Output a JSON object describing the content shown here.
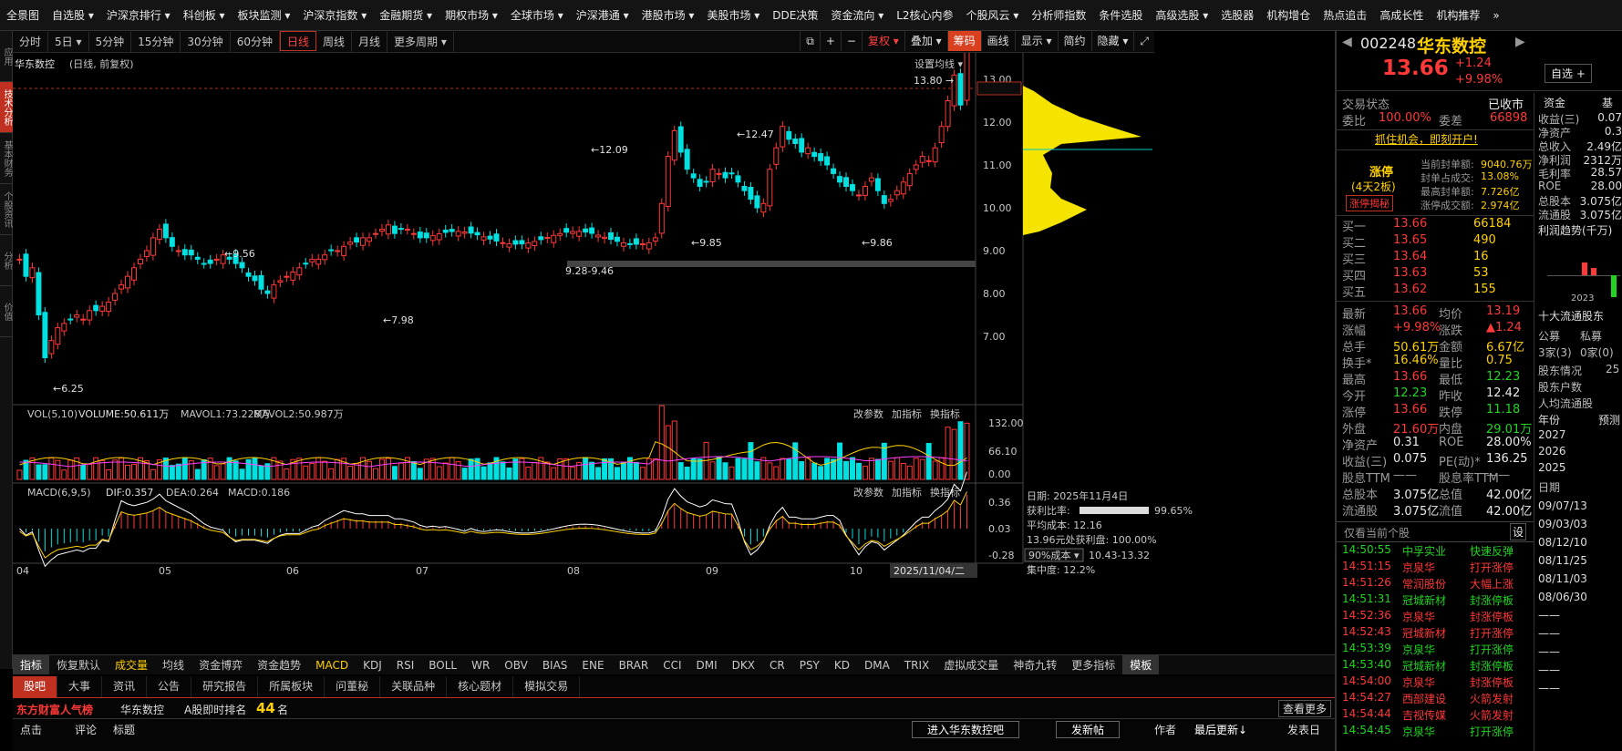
{
  "topmenu": [
    "全景图",
    "自选股 ▾",
    "沪深京排行 ▾",
    "科创板 ▾",
    "板块监测 ▾",
    "沪深京指数 ▾",
    "金融期货 ▾",
    "期权市场 ▾",
    "全球市场 ▾",
    "沪深港通 ▾",
    "港股市场 ▾",
    "美股市场 ▾",
    "DDE决策",
    "资金流向 ▾",
    "L2核心内参",
    "个股风云 ▾",
    "分析师指数",
    "条件选股",
    "高级选股 ▾",
    "选股器",
    "机构增仓",
    "热点追击",
    "高成长性",
    "机构推荐",
    "»"
  ],
  "periods": [
    "分时",
    "5日 ▾",
    "5分钟",
    "15分钟",
    "30分钟",
    "60分钟",
    "日线",
    "周线",
    "月线",
    "更多周期 ▾"
  ],
  "active_period": "日线",
  "toolbar": [
    "⧉",
    "+",
    "−",
    "复权 ▾",
    "叠加 ▾",
    "筹码",
    "画线",
    "显示 ▾",
    "简约",
    "隐藏 ▾",
    "⤢"
  ],
  "lefttabs": [
    "应用",
    "技术分析",
    "基本财务",
    "个股资讯",
    "分析",
    "价值"
  ],
  "stock": {
    "code": "002248",
    "name": "华东数控",
    "price": "13.66",
    "change": "+1.24",
    "pct": "+9.98%",
    "label": "华东数控",
    "sub": "(日线, 前复权)",
    "setting": "设置均线 ▾"
  },
  "chart_data": {
    "type": "candlestick",
    "ylim": [
      6,
      14
    ],
    "price_ticks": [
      "13.66",
      "13.00",
      "12.00",
      "11.00",
      "10.00",
      "9.00",
      "8.00",
      "7.00"
    ],
    "months": [
      "04",
      "05",
      "06",
      "07",
      "08",
      "09",
      "10",
      "11"
    ],
    "x_selected": "2025/11/04/二",
    "annotations": [
      {
        "t": "←6.25"
      },
      {
        "t": "←9.56"
      },
      {
        "t": "←7.98"
      },
      {
        "t": "←12.09"
      },
      {
        "t": "←12.47"
      },
      {
        "t": "←9.85"
      },
      {
        "t": "←9.86"
      },
      {
        "t": "13.80 →"
      },
      {
        "t": "9.28-9.46"
      }
    ],
    "volume": {
      "label": "VOL(5,10)",
      "v": "VOLUME:50.611万",
      "m1": "MAVOL1:73.228万",
      "m2": "MAVOL2:50.987万",
      "ticks": [
        "132.00",
        "66.10",
        "0.00"
      ]
    },
    "macd": {
      "label": "MACD(6,9,5)",
      "dif": "DIF:0.357",
      "dea": "DEA:0.264",
      "macd": "MACD:0.186",
      "ticks": [
        "0.36",
        "0.03",
        "-0.28"
      ]
    },
    "chip": {
      "date": "日期: 2025年11月4日",
      "profit_label": "获利比率:",
      "profit": "99.65%",
      "avg": "平均成本: 12.16",
      "p1396": "13.96元处获利盘: 100.00%",
      "cost_sel": "90%成本 ▾",
      "cost_range": "10.43-13.32",
      "conc": "集中度: 12.2%"
    }
  },
  "panel_btns": [
    "改参数",
    "加指标",
    "换指标"
  ],
  "indicators": [
    "指标",
    "恢复默认",
    "成交量",
    "均线",
    "资金博弈",
    "资金趋势",
    "MACD",
    "KDJ",
    "RSI",
    "BOLL",
    "WR",
    "OBV",
    "BIAS",
    "ENE",
    "BRAR",
    "CCI",
    "DMI",
    "DKX",
    "CR",
    "PSY",
    "KD",
    "DMA",
    "TRIX",
    "虚拟成交量",
    "神奇九转",
    "更多指标",
    "模板"
  ],
  "bottom": {
    "tabs": [
      "股吧",
      "大事",
      "资讯",
      "公告",
      "研究报告",
      "所属板块",
      "问董秘",
      "关联品种",
      "核心题材",
      "模拟交易"
    ],
    "popular": "东方财富人气榜",
    "name": "华东数控",
    "rank_label": "A股即时排名",
    "rank": "44",
    "rank_unit": "名",
    "more": "查看更多",
    "cols": [
      "点击",
      "评论",
      "标题"
    ],
    "btn1": "进入华东数控吧",
    "btn2": "发新帖",
    "c_author": "作者",
    "c_update": "最后更新↓",
    "c_post": "发表日"
  },
  "rp": {
    "status_l": "交易状态",
    "status_r": "已收市",
    "wb_l": "委比",
    "wb": "100.00%",
    "wc_l": "委差",
    "wc": "66898",
    "promo": "抓住机会，即刻开户!",
    "zt": "涨停",
    "zt_sub": "(4天2板)",
    "zt_btn": "涨停揭秘",
    "seal_k": [
      "当前封单额:",
      "封单占成交:",
      "最高封单额:",
      "涨停成交额:"
    ],
    "seal_v": [
      "9040.76万",
      "13.08%",
      "7.726亿",
      "2.974亿"
    ],
    "buy": [
      [
        "买一",
        "13.66",
        "66184"
      ],
      [
        "买二",
        "13.65",
        "490"
      ],
      [
        "买三",
        "13.64",
        "16"
      ],
      [
        "买四",
        "13.63",
        "53"
      ],
      [
        "买五",
        "13.62",
        "155"
      ]
    ],
    "stats": [
      [
        "最新",
        "13.66",
        "均价",
        "13.19"
      ],
      [
        "涨幅",
        "+9.98%",
        "涨跌",
        "▲1.24"
      ],
      [
        "总手",
        "50.61万",
        "金额",
        "6.67亿"
      ],
      [
        "换手*",
        "16.46%",
        "量比",
        "0.75"
      ],
      [
        "最高",
        "13.66",
        "最低",
        "12.23"
      ],
      [
        "今开",
        "12.23",
        "昨收",
        "12.42"
      ],
      [
        "涨停",
        "13.66",
        "跌停",
        "11.18"
      ],
      [
        "外盘",
        "21.60万",
        "内盘",
        "29.01万"
      ],
      [
        "净资产",
        "0.31",
        "ROE",
        "28.00%"
      ],
      [
        "收益(三)",
        "0.075",
        "PE(动)*",
        "136.25"
      ],
      [
        "股息TTM",
        "——",
        "股息率TTM",
        "——"
      ],
      [
        "总股本",
        "3.075亿",
        "总值",
        "42.00亿"
      ],
      [
        "流通股",
        "3.075亿",
        "流值",
        "42.00亿"
      ]
    ],
    "only_cur": "仅看当前个股",
    "set": "设",
    "ticks": [
      [
        "14:50:55",
        "中孚实业",
        "快速反弹"
      ],
      [
        "14:51:15",
        "京泉华",
        "打开涨停"
      ],
      [
        "14:51:26",
        "常润股份",
        "大幅上涨"
      ],
      [
        "14:51:31",
        "冠城新材",
        "封涨停板"
      ],
      [
        "14:52:36",
        "京泉华",
        "封涨停板"
      ],
      [
        "14:52:43",
        "冠城新材",
        "打开涨停"
      ],
      [
        "14:53:39",
        "京泉华",
        "打开涨停"
      ],
      [
        "14:53:40",
        "冠城新材",
        "封涨停板"
      ],
      [
        "14:54:00",
        "京泉华",
        "封涨停板"
      ],
      [
        "14:54:27",
        "西部建设",
        "火箭发射"
      ],
      [
        "14:54:44",
        "吉视传媒",
        "火箭发射"
      ],
      [
        "14:54:45",
        "京泉华",
        "打开涨停"
      ]
    ],
    "self_btn": "自选 +",
    "col_tabs": [
      "资金",
      "基"
    ],
    "col": [
      [
        "收益(三)",
        "0.07"
      ],
      [
        "净资产",
        "0.3"
      ],
      [
        "总收入",
        "2.49亿"
      ],
      [
        "净利润",
        "2312万"
      ],
      [
        "毛利率",
        "28.57"
      ],
      [
        "ROE",
        "28.00"
      ],
      [
        "总股本",
        "3.075亿"
      ],
      [
        "流通股",
        "3.075亿"
      ]
    ],
    "col_trend": "利润趋势(千万)",
    "col_year": "2023",
    "col_holders": "十大流通股东",
    "col_h": [
      "公募",
      "私募",
      "3家(3)",
      "0家(0)",
      "股东情况",
      "25",
      "股东户数",
      "人均流通股"
    ],
    "col_years": [
      "年份",
      "预测",
      "2027",
      "2026",
      "2025"
    ],
    "col_date": "日期",
    "col_dates": [
      "09/07/13",
      "09/03/03",
      "08/12/10",
      "08/11/25",
      "08/11/03",
      "08/06/30",
      "——",
      "——",
      "——",
      "——",
      "——"
    ]
  }
}
